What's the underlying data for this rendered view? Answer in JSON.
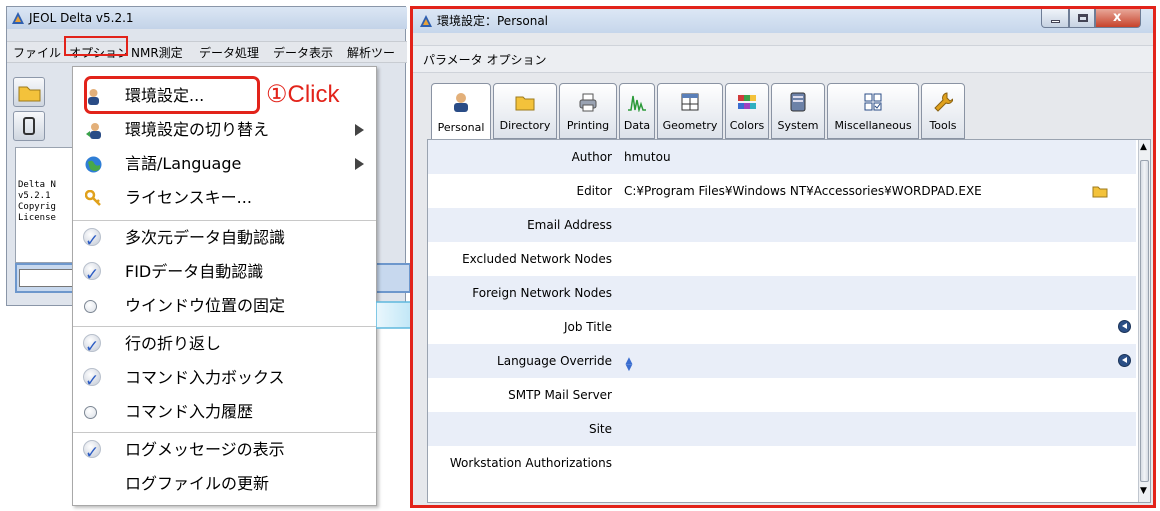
{
  "delta_window": {
    "title": "JEOL Delta  v5.2.1",
    "menu": [
      "ファイル",
      "オプション",
      "NMR測定",
      "データ処理",
      "データ表示",
      "解析ツー"
    ],
    "console_lines": [
      "Delta N",
      "v5.2.1",
      "Copyrig",
      "License"
    ]
  },
  "options_menu": {
    "items": [
      {
        "label": "環境設定...",
        "icon": "person-icon",
        "kind": "normal"
      },
      {
        "label": "環境設定の切り替え",
        "icon": "person-switch-icon",
        "kind": "submenu"
      },
      {
        "label": "言語/Language",
        "icon": "globe-icon",
        "kind": "submenu"
      },
      {
        "label": "ライセンスキー...",
        "icon": "key-icon",
        "kind": "normal"
      },
      {
        "label": "多次元データ自動認識",
        "kind": "check",
        "checked": true
      },
      {
        "label": "FIDデータ自動認識",
        "kind": "check",
        "checked": true
      },
      {
        "label": "ウインドウ位置の固定",
        "kind": "radio",
        "checked": false
      },
      {
        "label": "行の折り返し",
        "kind": "check",
        "checked": true
      },
      {
        "label": "コマンド入力ボックス",
        "kind": "check",
        "checked": true
      },
      {
        "label": "コマンド入力履歴",
        "kind": "radio",
        "checked": false
      },
      {
        "label": "ログメッセージの表示",
        "kind": "check",
        "checked": true
      },
      {
        "label": "ログファイルの更新",
        "kind": "normal"
      }
    ]
  },
  "annotation": {
    "callout": "①Click",
    "accent": "#e2231a"
  },
  "settings_window": {
    "title": "環境設定：Personal",
    "menu": "パラメータ  オプション",
    "tabs": [
      {
        "label": "Personal",
        "icon": "person-icon"
      },
      {
        "label": "Directory",
        "icon": "folder-icon"
      },
      {
        "label": "Printing",
        "icon": "printer-icon"
      },
      {
        "label": "Data",
        "icon": "spectrum-icon"
      },
      {
        "label": "Geometry",
        "icon": "geometry-icon"
      },
      {
        "label": "Colors",
        "icon": "colors-icon"
      },
      {
        "label": "System",
        "icon": "system-icon"
      },
      {
        "label": "Miscellaneous",
        "icon": "miscellaneous-icon"
      },
      {
        "label": "Tools",
        "icon": "wrench-icon"
      }
    ],
    "rows": [
      {
        "label": "Author",
        "value": "hmutou"
      },
      {
        "label": "Editor",
        "value": "C:¥Program Files¥Windows NT¥Accessories¥WORDPAD.EXE"
      },
      {
        "label": "Email Address",
        "value": ""
      },
      {
        "label": "Excluded Network Nodes",
        "value": ""
      },
      {
        "label": "Foreign Network Nodes",
        "value": ""
      },
      {
        "label": "Job Title",
        "value": ""
      },
      {
        "label": "Language Override",
        "value": "▲▼"
      },
      {
        "label": "SMTP Mail Server",
        "value": ""
      },
      {
        "label": "Site",
        "value": ""
      },
      {
        "label": "Workstation Authorizations",
        "value": ""
      }
    ]
  }
}
